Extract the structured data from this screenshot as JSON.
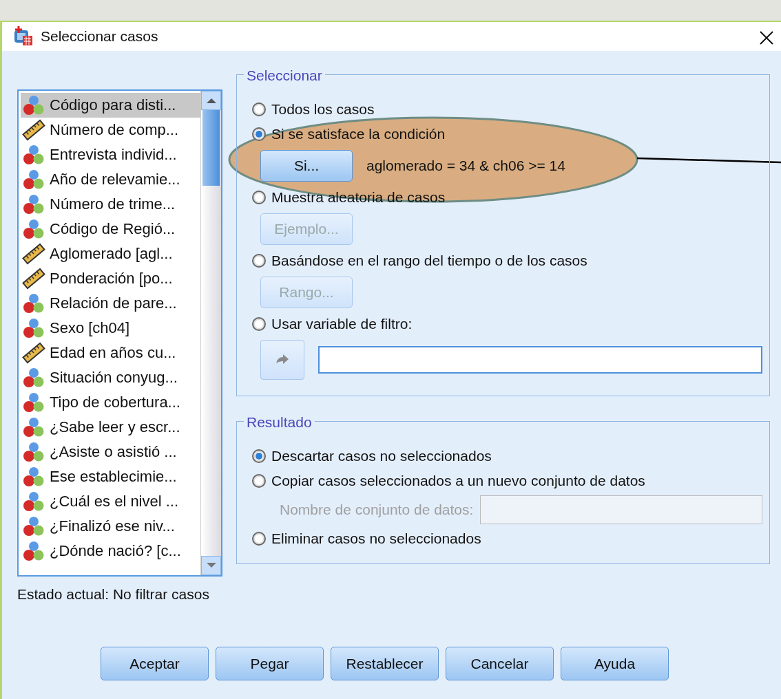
{
  "window": {
    "title": "Seleccionar casos"
  },
  "variables": [
    {
      "label": "Código para disti...",
      "kind": "nominal",
      "selected": true
    },
    {
      "label": "Número de comp...",
      "kind": "scale",
      "selected": false
    },
    {
      "label": "Entrevista individ...",
      "kind": "nominal",
      "selected": false
    },
    {
      "label": "Año de relevamie...",
      "kind": "nominal",
      "selected": false
    },
    {
      "label": "Número de trime...",
      "kind": "nominal",
      "selected": false
    },
    {
      "label": "Código de Regió...",
      "kind": "nominal",
      "selected": false
    },
    {
      "label": "Aglomerado [agl...",
      "kind": "scale",
      "selected": false
    },
    {
      "label": "Ponderación [po...",
      "kind": "scale",
      "selected": false
    },
    {
      "label": "Relación de pare...",
      "kind": "nominal",
      "selected": false
    },
    {
      "label": "Sexo [ch04]",
      "kind": "nominal",
      "selected": false
    },
    {
      "label": "Edad en años cu...",
      "kind": "scale",
      "selected": false
    },
    {
      "label": "Situación conyug...",
      "kind": "nominal",
      "selected": false
    },
    {
      "label": "Tipo de cobertura...",
      "kind": "nominal",
      "selected": false
    },
    {
      "label": "¿Sabe leer y escr...",
      "kind": "nominal",
      "selected": false
    },
    {
      "label": "¿Asiste o asistió ...",
      "kind": "nominal",
      "selected": false
    },
    {
      "label": "Ese establecimie...",
      "kind": "nominal",
      "selected": false
    },
    {
      "label": "¿Cuál es el nivel ...",
      "kind": "nominal",
      "selected": false
    },
    {
      "label": "¿Finalizó ese niv...",
      "kind": "nominal",
      "selected": false
    },
    {
      "label": "¿Dónde nació? [c...",
      "kind": "nominal",
      "selected": false
    }
  ],
  "select_group": {
    "legend": "Seleccionar",
    "options": [
      {
        "kind": "plain",
        "label": "Todos los casos",
        "selected": false
      },
      {
        "kind": "condition",
        "label": "Si se satisface la condición",
        "selected": true,
        "button": {
          "label": "Si...",
          "disabled": false
        },
        "condition": "aglomerado = 34 & ch06 >= 14"
      },
      {
        "kind": "button",
        "label": "Muestra aleatoria de casos",
        "selected": false,
        "button": {
          "label": "Ejemplo...",
          "disabled": true
        }
      },
      {
        "kind": "button",
        "label": "Basándose en el rango del tiempo o de los casos",
        "selected": false,
        "button": {
          "label": "Rango...",
          "disabled": true
        }
      },
      {
        "kind": "filter",
        "label": "Usar variable de filtro:",
        "selected": false
      }
    ]
  },
  "result_group": {
    "legend": "Resultado",
    "options": [
      {
        "kind": "plain",
        "label": "Descartar casos no seleccionados",
        "selected": true
      },
      {
        "kind": "name",
        "label": "Copiar casos seleccionados a un nuevo conjunto de datos",
        "selected": false,
        "name_label": "Nombre de conjunto de datos:",
        "disabled": true
      },
      {
        "kind": "plain",
        "label": "Eliminar casos no seleccionados",
        "selected": false
      }
    ]
  },
  "status": "Estado actual: No filtrar casos",
  "buttons": [
    {
      "label": "Aceptar"
    },
    {
      "label": "Pegar"
    },
    {
      "label": "Restablecer"
    },
    {
      "label": "Cancelar"
    },
    {
      "label": "Ayuda"
    }
  ]
}
